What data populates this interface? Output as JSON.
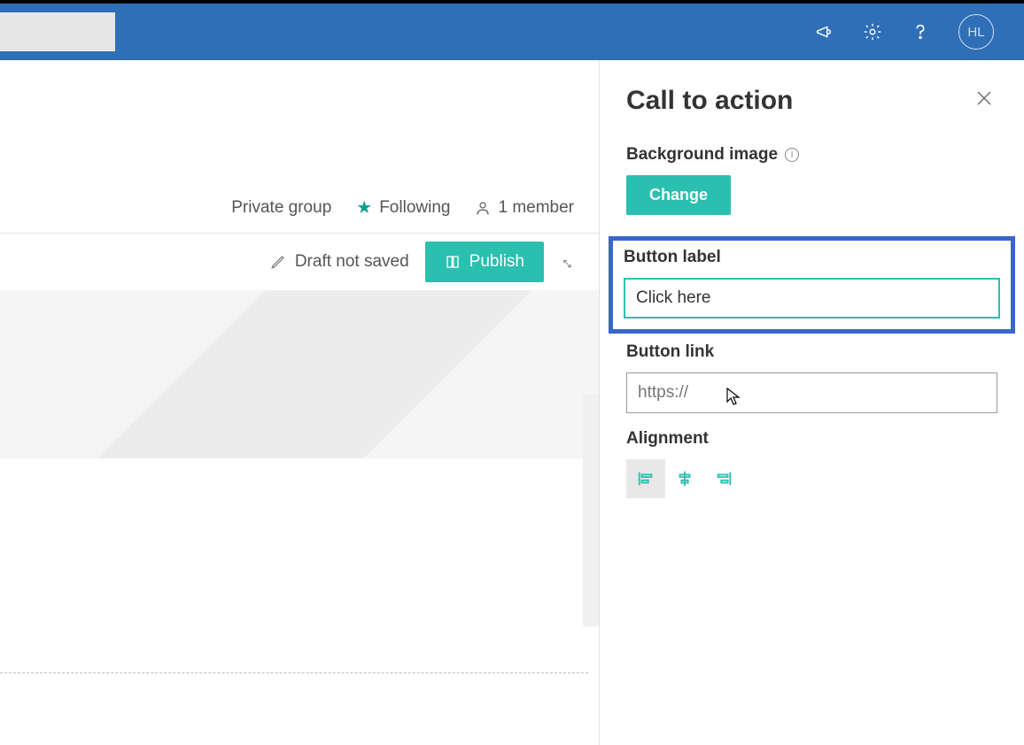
{
  "topbar": {
    "avatar_initials": "HL"
  },
  "group": {
    "privacy": "Private group",
    "following_label": "Following",
    "members_label": "1 member"
  },
  "toolbar": {
    "draft_status": "Draft not saved",
    "publish_label": "Publish"
  },
  "panel": {
    "title": "Call to action",
    "background_image_label": "Background image",
    "change_label": "Change",
    "button_label_label": "Button label",
    "button_label_value": "Click here",
    "button_link_label": "Button link",
    "button_link_placeholder": "https://",
    "alignment_label": "Alignment"
  }
}
